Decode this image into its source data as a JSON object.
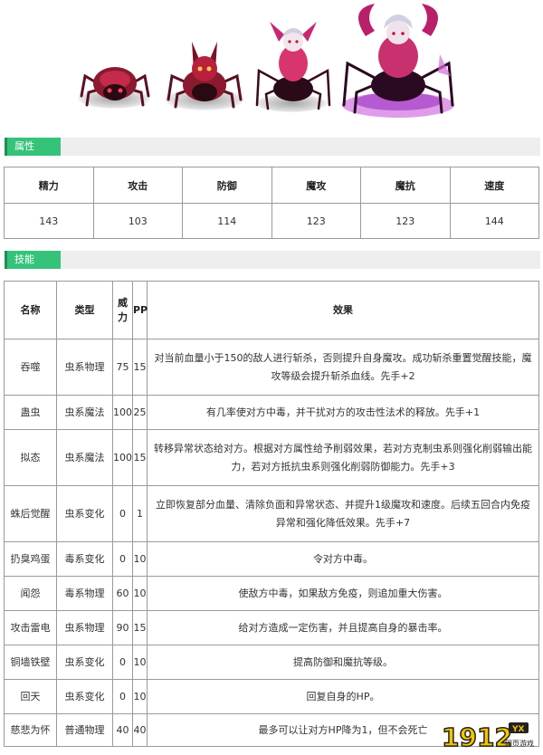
{
  "sections": {
    "attributes": "属性",
    "skills": "技能"
  },
  "stats": {
    "headers": [
      "精力",
      "攻击",
      "防御",
      "魔攻",
      "魔抗",
      "速度"
    ],
    "values": [
      "143",
      "103",
      "114",
      "123",
      "123",
      "144"
    ]
  },
  "skills": {
    "headers": {
      "name": "名称",
      "type": "类型",
      "power": "威力",
      "pp": "PP",
      "effect": "效果"
    },
    "rows": [
      {
        "name": "吞噬",
        "type": "虫系物理",
        "power": "75",
        "pp": "15",
        "effect": "对当前血量小于150的敌人进行斩杀，否则提升自身魔攻。成功斩杀重置觉醒技能，魔攻等级会提升斩杀血线。先手+2"
      },
      {
        "name": "蛊虫",
        "type": "虫系魔法",
        "power": "100",
        "pp": "25",
        "effect": "有几率使对方中毒，并干扰对方的攻击性法术的释放。先手+1"
      },
      {
        "name": "拟态",
        "type": "虫系魔法",
        "power": "100",
        "pp": "15",
        "effect": "转移异常状态给对方。根据对方属性给予削弱效果，若对方克制虫系则强化削弱输出能力，若对方抵抗虫系则强化削弱防御能力。先手+3"
      },
      {
        "name": "蛛后觉醒",
        "type": "虫系变化",
        "power": "0",
        "pp": "1",
        "effect": "立即恢复部分血量、清除负面和异常状态、并提升1级魔攻和速度。后续五回合内免疫异常和强化降低效果。先手+7"
      },
      {
        "name": "扔臭鸡蛋",
        "type": "毒系变化",
        "power": "0",
        "pp": "10",
        "effect": "令对方中毒。"
      },
      {
        "name": "闻怨",
        "type": "毒系物理",
        "power": "60",
        "pp": "10",
        "effect": "使敌方中毒，如果敌方免疫，则追加重大伤害。"
      },
      {
        "name": "攻击雷电",
        "type": "虫系物理",
        "power": "90",
        "pp": "15",
        "effect": "给对方造成一定伤害，并且提高自身的暴击率。"
      },
      {
        "name": "铜墙铁壁",
        "type": "虫系变化",
        "power": "0",
        "pp": "10",
        "effect": "提高防御和魔抗等级。"
      },
      {
        "name": "回天",
        "type": "虫系变化",
        "power": "0",
        "pp": "10",
        "effect": "回复自身的HP。"
      },
      {
        "name": "慈悲为怀",
        "type": "普通物理",
        "power": "40",
        "pp": "40",
        "effect": "最多可以让对方HP降为1，但不会死亡"
      }
    ]
  },
  "watermark": {
    "logo": "1912",
    "sub": "YX",
    "tagline": "网页游戏"
  },
  "colors": {
    "tab_green": "#35c37a",
    "bar_gray": "#eeeeee",
    "border": "#9a9a9a"
  }
}
